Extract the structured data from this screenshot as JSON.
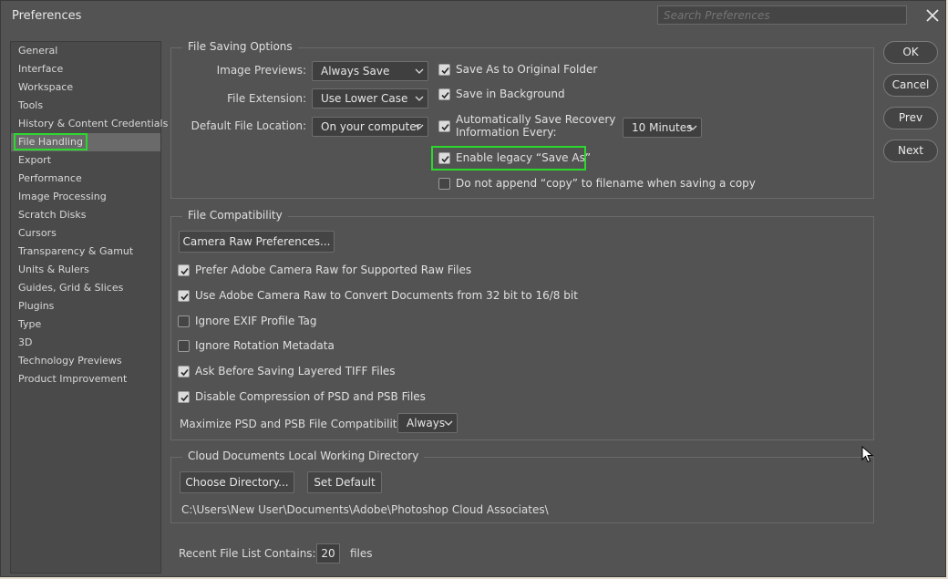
{
  "window": {
    "title": "Preferences",
    "search_placeholder": "Search Preferences"
  },
  "sidebar": {
    "items": [
      {
        "label": "General"
      },
      {
        "label": "Interface"
      },
      {
        "label": "Workspace"
      },
      {
        "label": "Tools"
      },
      {
        "label": "History & Content Credentials"
      },
      {
        "label": "File Handling",
        "selected": true
      },
      {
        "label": "Export"
      },
      {
        "label": "Performance"
      },
      {
        "label": "Image Processing"
      },
      {
        "label": "Scratch Disks"
      },
      {
        "label": "Cursors"
      },
      {
        "label": "Transparency & Gamut"
      },
      {
        "label": "Units & Rulers"
      },
      {
        "label": "Guides, Grid & Slices"
      },
      {
        "label": "Plugins"
      },
      {
        "label": "Type"
      },
      {
        "label": "3D"
      },
      {
        "label": "Technology Previews"
      },
      {
        "label": "Product Improvement"
      }
    ]
  },
  "file_saving": {
    "title": "File Saving Options",
    "image_previews_label": "Image Previews:",
    "image_previews_value": "Always Save",
    "file_extension_label": "File Extension:",
    "file_extension_value": "Use Lower Case",
    "default_location_label": "Default File Location:",
    "default_location_value": "On your computer",
    "save_as_original": {
      "label": "Save As to Original Folder",
      "checked": true
    },
    "save_background": {
      "label": "Save in Background",
      "checked": true
    },
    "auto_save": {
      "label_line1": "Automatically Save Recovery",
      "label_line2": "Information Every:",
      "checked": true
    },
    "auto_save_interval": "10 Minutes",
    "legacy_save_as": {
      "label": "Enable legacy “Save As”",
      "checked": true
    },
    "no_copy": {
      "label": "Do not append “copy” to filename when saving a copy",
      "checked": false
    }
  },
  "file_compat": {
    "title": "File Compatibility",
    "camera_raw_button": "Camera Raw Preferences...",
    "options": [
      {
        "label": "Prefer Adobe Camera Raw for Supported Raw Files",
        "checked": true
      },
      {
        "label": "Use Adobe Camera Raw to Convert Documents from 32 bit to 16/8 bit",
        "checked": true
      },
      {
        "label": "Ignore EXIF Profile Tag",
        "checked": false
      },
      {
        "label": "Ignore Rotation Metadata",
        "checked": false
      },
      {
        "label": "Ask Before Saving Layered TIFF Files",
        "checked": true
      },
      {
        "label": "Disable Compression of PSD and PSB Files",
        "checked": true
      }
    ],
    "maximize_label": "Maximize PSD and PSB File Compatibility:",
    "maximize_value": "Always"
  },
  "cloud_docs": {
    "title": "Cloud Documents Local Working Directory",
    "choose_button": "Choose Directory...",
    "default_button": "Set Default",
    "path": "C:\\Users\\New User\\Documents\\Adobe\\Photoshop Cloud Associates\\"
  },
  "recent": {
    "label": "Recent File List Contains:",
    "value": "20",
    "suffix": "files"
  },
  "buttons": {
    "ok": "OK",
    "cancel": "Cancel",
    "prev": "Prev",
    "next": "Next"
  },
  "colors": {
    "highlight": "#2dd82d",
    "panel": "#535353"
  }
}
